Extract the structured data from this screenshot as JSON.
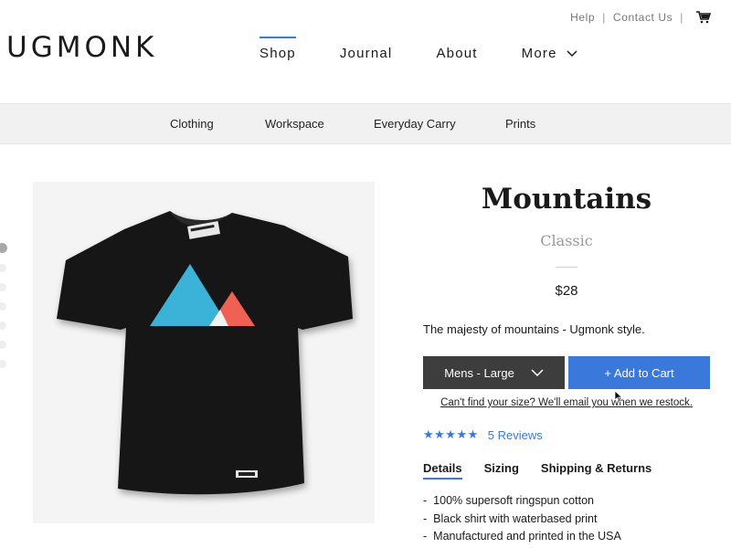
{
  "header": {
    "logo": "UGMONK",
    "util_links": [
      {
        "label": "Help"
      },
      {
        "label": "Contact Us"
      }
    ],
    "cart_icon": "cart-icon",
    "nav": [
      {
        "label": "Shop",
        "active": true
      },
      {
        "label": "Journal",
        "active": false
      },
      {
        "label": "About",
        "active": false
      },
      {
        "label": "More",
        "active": false
      }
    ],
    "accent": "#3a7be0"
  },
  "categories": [
    {
      "label": "Clothing"
    },
    {
      "label": "Workspace"
    },
    {
      "label": "Everyday Carry"
    },
    {
      "label": "Prints"
    }
  ],
  "gallery": {
    "image_icon": "black-tshirt-mountains-graphic",
    "selected_index": 0,
    "total": 7
  },
  "product": {
    "title": "Mountains",
    "subtitle": "Classic",
    "price": "$28",
    "description": "The majesty of mountains - Ugmonk style.",
    "size_selected": "Mens - Large",
    "add_to_cart": "+ Add to Cart",
    "restock_link": "Can't find your size? We'll email you when we restock.",
    "rating_stars": "★★★★★",
    "rating": 5,
    "reviews_label": "5 Reviews",
    "tabs": [
      {
        "label": "Details",
        "active": true
      },
      {
        "label": "Sizing",
        "active": false
      },
      {
        "label": "Shipping & Returns",
        "active": false
      }
    ],
    "details": [
      "100% supersoft ringspun cotton",
      "Black shirt with waterbased print",
      "Manufactured and printed in the USA"
    ]
  },
  "colors": {
    "button_dark": "#3d3d3d",
    "button_blue": "#3a78dc",
    "category_bg": "#f1f1f1"
  }
}
